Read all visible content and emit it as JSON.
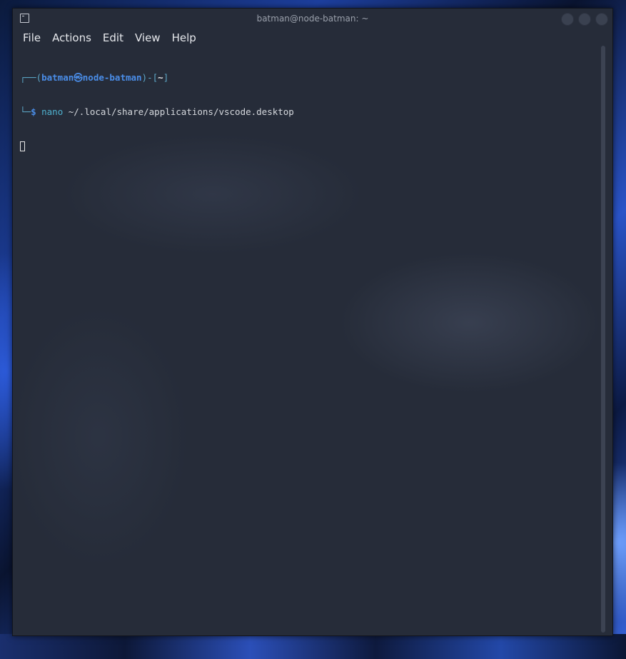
{
  "window": {
    "title": "batman@node-batman: ~"
  },
  "menu": {
    "items": [
      "File",
      "Actions",
      "Edit",
      "View",
      "Help"
    ]
  },
  "terminal": {
    "prompt_top_left": "┌──(",
    "user": "batman",
    "at_symbol": "㉿",
    "host": "node-batman",
    "prompt_mid": ")-[",
    "cwd": "~",
    "prompt_end": "]",
    "prompt_bottom_left": "└─",
    "dollar": "$",
    "command_name": "nano",
    "command_args": " ~/.local/share/applications/vscode.desktop"
  },
  "colors": {
    "background": "#262c39",
    "prompt_blue": "#4a8de8",
    "prompt_cyan": "#5da8c8"
  }
}
